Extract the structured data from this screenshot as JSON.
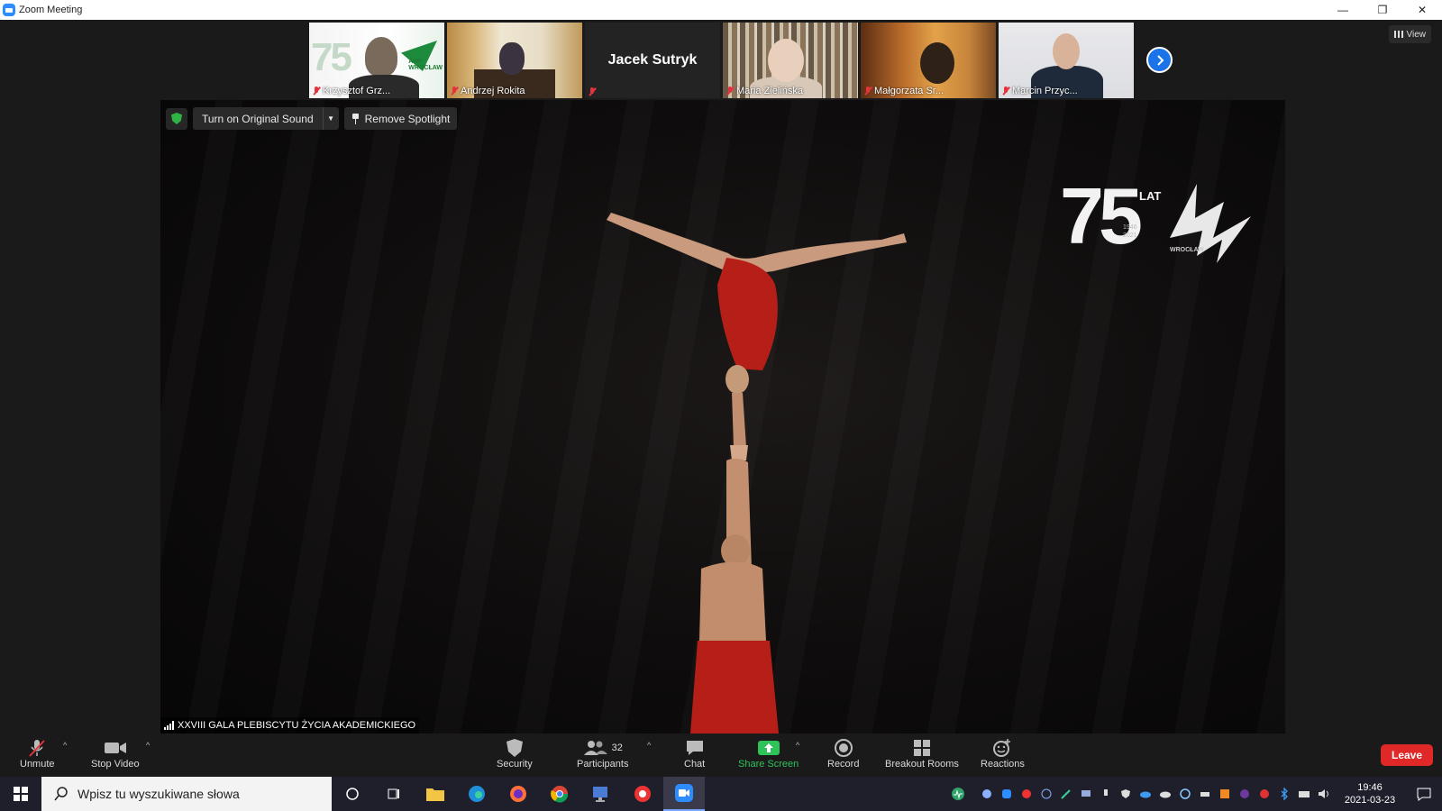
{
  "window": {
    "title": "Zoom Meeting",
    "minimize_glyph": "—",
    "restore_glyph": "❐",
    "close_glyph": "✕"
  },
  "participants": [
    {
      "name": "Krzysztof Grz...",
      "muted": true
    },
    {
      "name": "Andrzej Rokita",
      "muted": true
    },
    {
      "name": "Jacek Sutryk",
      "muted": true
    },
    {
      "name": "Maria Zielińska",
      "muted": true
    },
    {
      "name": "Małgorzata Sr...",
      "muted": true
    },
    {
      "name": "Marcin Przyc...",
      "muted": true
    }
  ],
  "thumb_logo": {
    "number": "75",
    "brand": "AWF",
    "city": "WROCŁAW"
  },
  "view_button": {
    "label": "View"
  },
  "stage": {
    "original_sound_label": "Turn on Original Sound",
    "remove_spotlight_label": "Remove Spotlight",
    "caption": "XXVIII GALA PLEBISCYTU ŻYCIA AKADEMICKIEGO",
    "logo": {
      "number": "75",
      "suffix": "LAT",
      "years_1": "1946",
      "years_2": "2021",
      "city": "WROCŁAW"
    }
  },
  "toolbar": {
    "unmute": "Unmute",
    "stop_video": "Stop Video",
    "security": "Security",
    "participants": "Participants",
    "participants_count": "32",
    "chat": "Chat",
    "share_screen": "Share Screen",
    "record": "Record",
    "breakout_rooms": "Breakout Rooms",
    "reactions": "Reactions",
    "leave": "Leave"
  },
  "taskbar": {
    "search_placeholder": "Wpisz tu wyszukiwane słowa",
    "time": "19:46",
    "date": "2021-03-23"
  },
  "colors": {
    "accent_blue": "#2d8cff",
    "leave_red": "#e02828",
    "share_green": "#2fc25b",
    "muted_red": "#e5323c"
  }
}
